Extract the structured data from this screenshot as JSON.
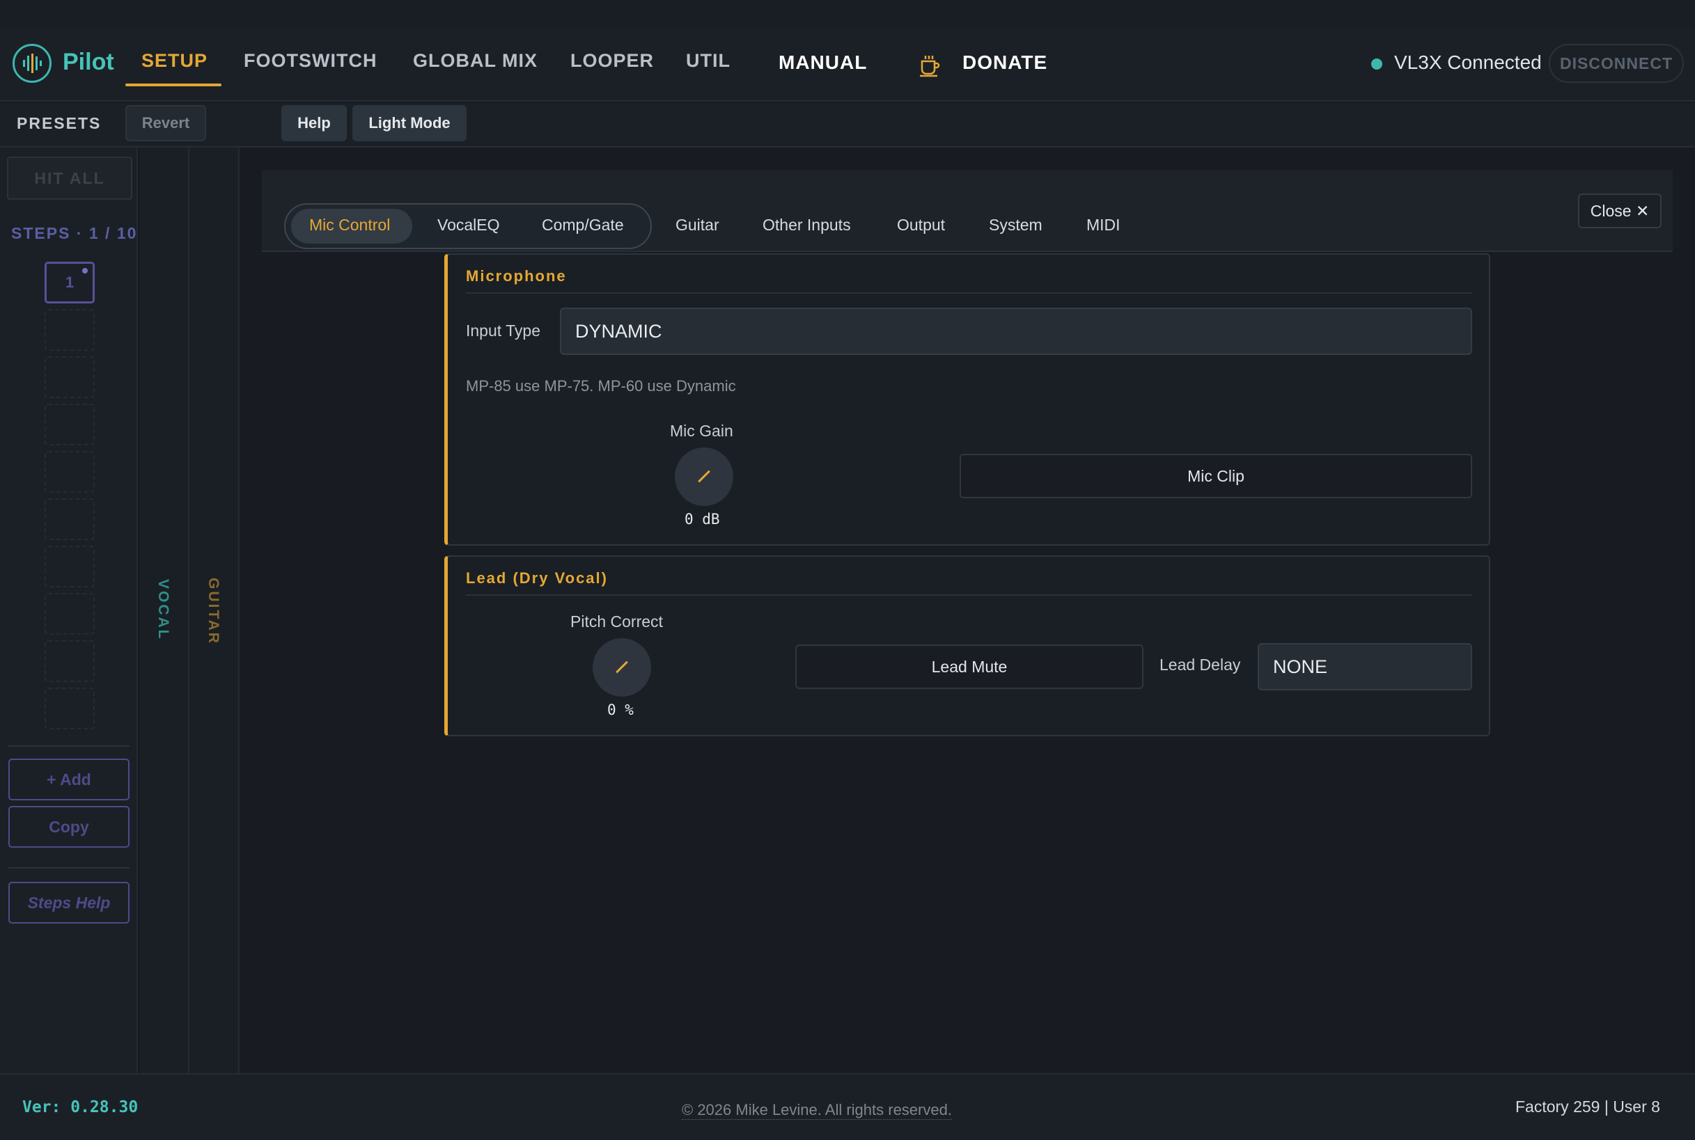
{
  "app": {
    "name": "Pilot"
  },
  "nav": {
    "setup": "SETUP",
    "footswitch": "FOOTSWITCH",
    "global_mix": "GLOBAL MIX",
    "looper": "LOOPER",
    "util": "UTIL",
    "manual": "MANUAL",
    "donate": "DONATE"
  },
  "connection": {
    "status": "VL3X Connected",
    "disconnect": "DISCONNECT",
    "status_color": "#3fb7ad"
  },
  "toolbar": {
    "presets": "PRESETS",
    "revert": "Revert",
    "help": "Help",
    "light_mode": "Light Mode"
  },
  "sidebar": {
    "hit_all": "HIT ALL",
    "steps_label": "STEPS · 1 / 10",
    "active_step": "1",
    "add": "+ Add",
    "copy": "Copy",
    "steps_help": "Steps Help"
  },
  "strips": {
    "vocal": "VOCAL",
    "guitar": "GUITAR"
  },
  "tabs": {
    "mic_control": "Mic Control",
    "vocal_eq": "VocalEQ",
    "comp_gate": "Comp/Gate",
    "guitar": "Guitar",
    "other_inputs": "Other Inputs",
    "output": "Output",
    "system": "System",
    "midi": "MIDI",
    "close": "Close ✕"
  },
  "microphone": {
    "title": "Microphone",
    "input_type_label": "Input Type",
    "input_type_value": "DYNAMIC",
    "hint": "MP-85 use MP-75. MP-60 use Dynamic",
    "mic_gain_label": "Mic Gain",
    "mic_gain_value": "0 dB",
    "mic_clip": "Mic Clip"
  },
  "lead": {
    "title": "Lead (Dry Vocal)",
    "pitch_correct_label": "Pitch Correct",
    "pitch_correct_value": "0 %",
    "lead_mute": "Lead Mute",
    "lead_delay_label": "Lead Delay",
    "lead_delay_value": "NONE"
  },
  "footer": {
    "version": "Ver: 0.28.30",
    "copyright": "© 2026 Mike Levine. All rights reserved.",
    "counts": "Factory 259 | User 8"
  },
  "colors": {
    "accent": "#e5a834",
    "teal": "#47c3b8",
    "purple": "#5a4f9c"
  }
}
